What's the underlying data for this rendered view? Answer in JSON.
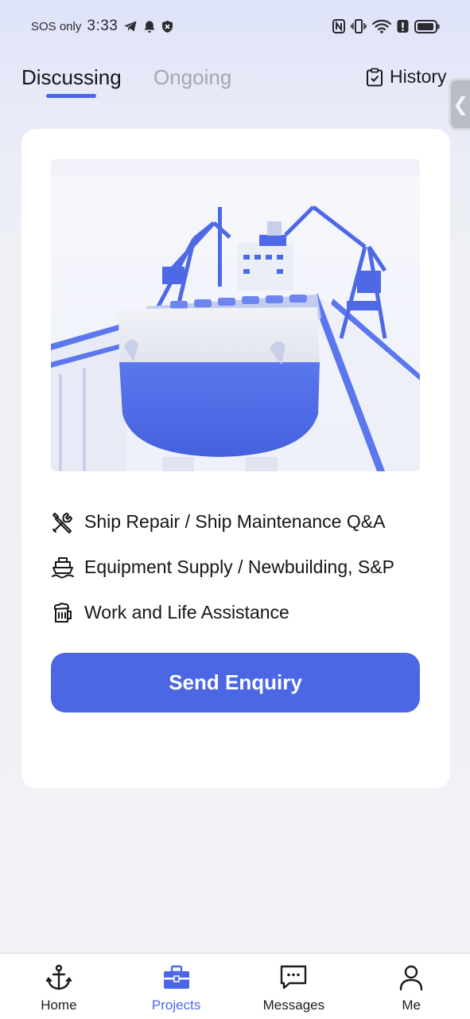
{
  "status_bar": {
    "carrier": "SOS only",
    "time": "3:33"
  },
  "header": {
    "tabs": [
      {
        "label": "Discussing",
        "active": true
      },
      {
        "label": "Ongoing",
        "active": false
      }
    ],
    "history_label": "History"
  },
  "card": {
    "features": [
      {
        "icon": "tools-icon",
        "label": "Ship Repair / Ship Maintenance Q&A"
      },
      {
        "icon": "ship-icon",
        "label": "Equipment Supply / Newbuilding, S&P"
      },
      {
        "icon": "beer-mug-icon",
        "label": "Work and Life Assistance"
      }
    ],
    "send_button": "Send Enquiry"
  },
  "bottom_nav": {
    "items": [
      {
        "icon": "anchor-icon",
        "label": "Home",
        "active": false
      },
      {
        "icon": "briefcase-icon",
        "label": "Projects",
        "active": true
      },
      {
        "icon": "message-icon",
        "label": "Messages",
        "active": false
      },
      {
        "icon": "person-icon",
        "label": "Me",
        "active": false
      }
    ]
  },
  "colors": {
    "accent": "#4b67e3",
    "inactive_tab": "#a6a8ae"
  }
}
